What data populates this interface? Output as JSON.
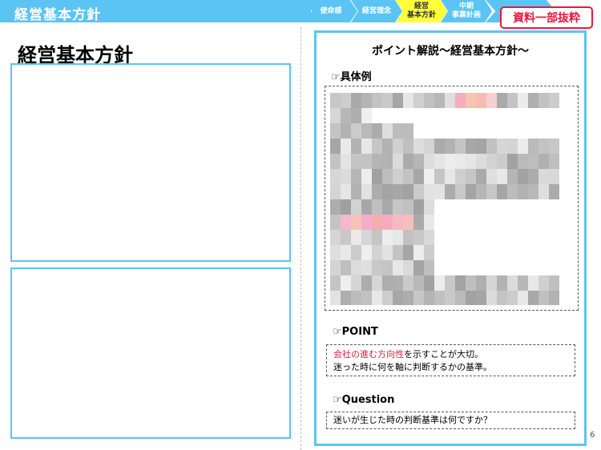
{
  "header": {
    "title": "経営基本方針",
    "steps": [
      {
        "label": "使命感"
      },
      {
        "label": "経営理念"
      },
      {
        "label": "経営\n基本方針"
      },
      {
        "label": "中期\n事業計画"
      }
    ],
    "badge": "資料一部抜粋"
  },
  "left": {
    "title": "経営基本方針"
  },
  "right": {
    "title": "ポイント解説～経営基本方針～",
    "example_label": "☞具体例",
    "point_label": "☞POINT",
    "point_highlight": "会社の進む方向性",
    "point_line1_rest": "を示すことが大切。",
    "point_line2": "迷った時に何を軸に判断するかの基準。",
    "question_label": "☞Question",
    "question_text": "迷いが生じた時の判断基準は何ですか？"
  },
  "colors": {
    "accent_blue": "#5bc4f5",
    "active_step_yellow": "#ffff3c",
    "badge_red": "#e8193c"
  },
  "page_number": "6"
}
